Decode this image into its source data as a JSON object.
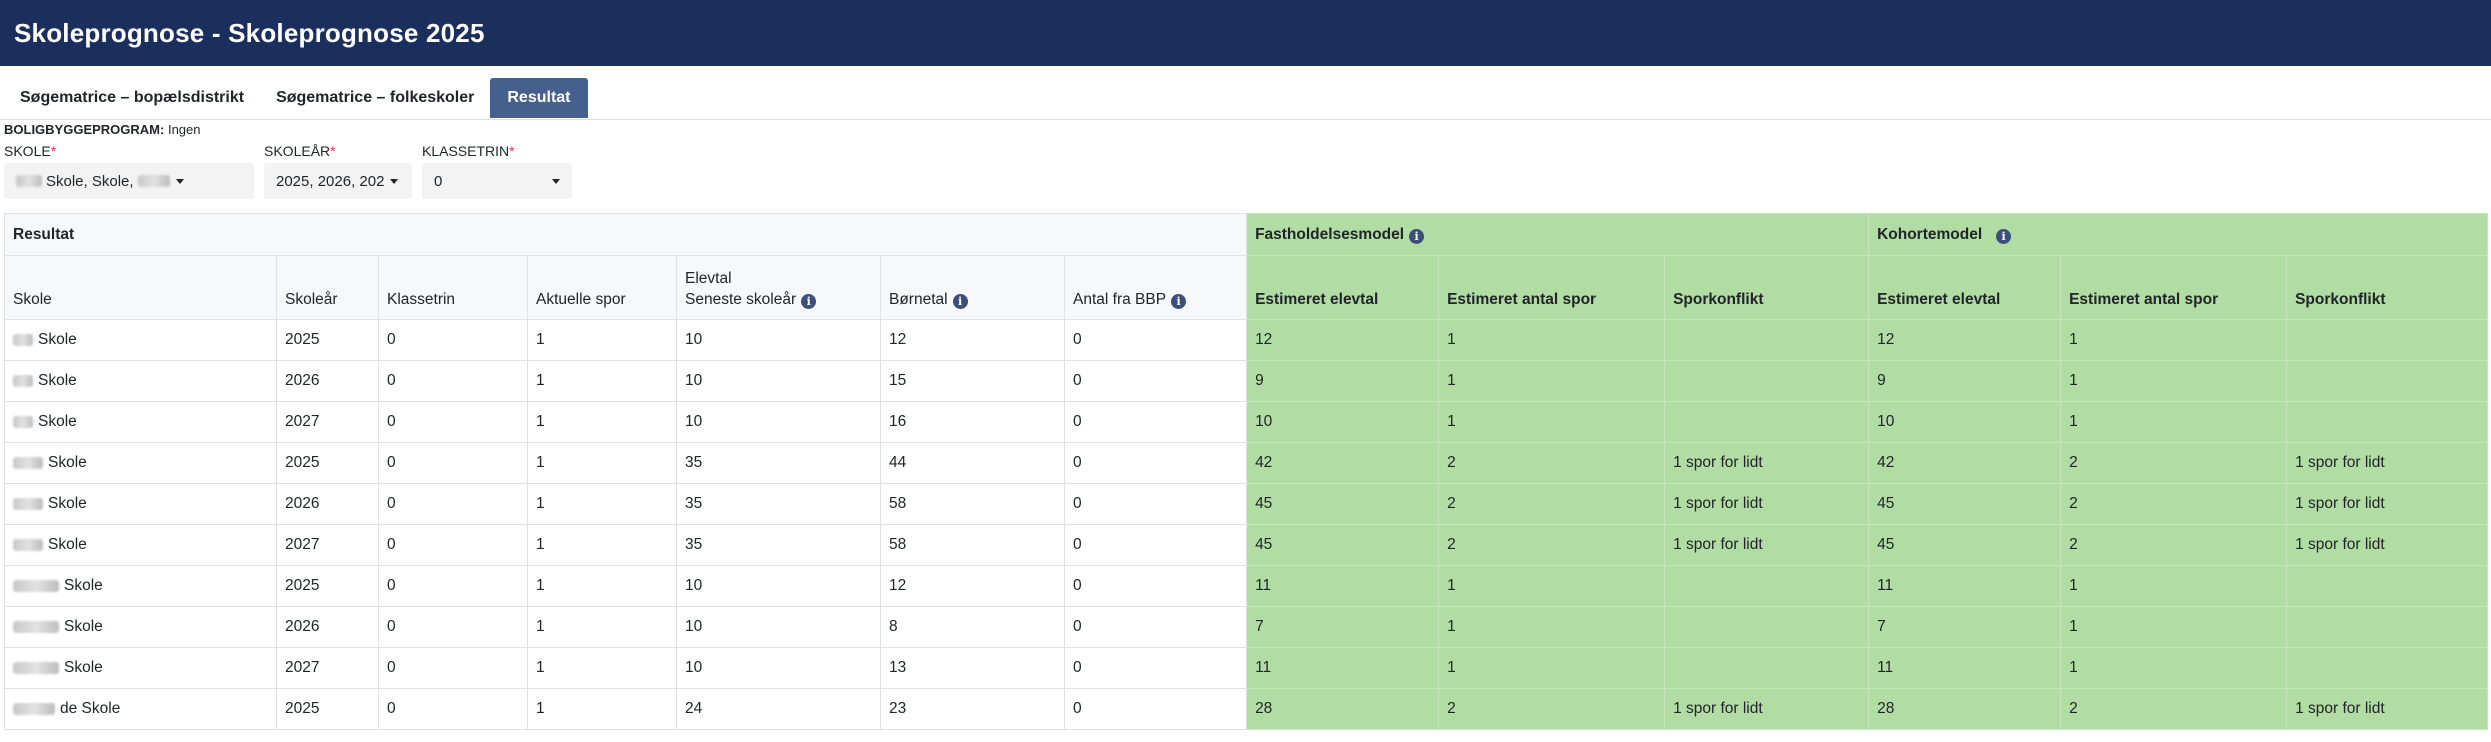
{
  "app": {
    "title": "Skoleprognose - Skoleprognose 2025"
  },
  "tabs": [
    {
      "label": "Søgematrice – bopælsdistrikt",
      "active": false
    },
    {
      "label": "Søgematrice – folkeskoler",
      "active": false
    },
    {
      "label": "Resultat",
      "active": true
    }
  ],
  "program": {
    "label": "BOLIGBYGGEPROGRAM:",
    "value": "Ingen"
  },
  "filters": {
    "school": {
      "label": "SKOLE",
      "required": "*",
      "value": "Skole, Skole,"
    },
    "year": {
      "label": "SKOLEÅR",
      "required": "*",
      "value": "2025, 2026, 202"
    },
    "class": {
      "label": "KLASSETRIN",
      "required": "*",
      "value": "0"
    }
  },
  "table": {
    "group_headers": {
      "result": "Resultat",
      "retention": "Fastholdelsesmodel",
      "cohort": "Kohortemodel"
    },
    "columns": {
      "school": "Skole",
      "year": "Skoleår",
      "grade": "Klassetrin",
      "tracks": "Aktuelle spor",
      "pupils_line1": "Elevtal",
      "pupils_line2": "Seneste skoleår",
      "children": "Børnetal",
      "bbp": "Antal fra BBP",
      "ret_est_pupils": "Estimeret elevtal",
      "ret_est_tracks": "Estimeret antal spor",
      "ret_conflict": "Sporkonflikt",
      "coh_est_pupils": "Estimeret elevtal",
      "coh_est_tracks": "Estimeret antal spor",
      "coh_conflict": "Sporkonflikt"
    },
    "rows": [
      {
        "school": "Skole",
        "year": "2025",
        "grade": "0",
        "tracks": "1",
        "pupils": "10",
        "children": "12",
        "bbp": "0",
        "r_pupils": "12",
        "r_tracks": "1",
        "r_conflict": "",
        "c_pupils": "12",
        "c_tracks": "1",
        "c_conflict": ""
      },
      {
        "school": "Skole",
        "year": "2026",
        "grade": "0",
        "tracks": "1",
        "pupils": "10",
        "children": "15",
        "bbp": "0",
        "r_pupils": "9",
        "r_tracks": "1",
        "r_conflict": "",
        "c_pupils": "9",
        "c_tracks": "1",
        "c_conflict": ""
      },
      {
        "school": "Skole",
        "year": "2027",
        "grade": "0",
        "tracks": "1",
        "pupils": "10",
        "children": "16",
        "bbp": "0",
        "r_pupils": "10",
        "r_tracks": "1",
        "r_conflict": "",
        "c_pupils": "10",
        "c_tracks": "1",
        "c_conflict": ""
      },
      {
        "school": "Skole",
        "year": "2025",
        "grade": "0",
        "tracks": "1",
        "pupils": "35",
        "children": "44",
        "bbp": "0",
        "r_pupils": "42",
        "r_tracks": "2",
        "r_conflict": "1 spor for lidt",
        "c_pupils": "42",
        "c_tracks": "2",
        "c_conflict": "1 spor for lidt"
      },
      {
        "school": "Skole",
        "year": "2026",
        "grade": "0",
        "tracks": "1",
        "pupils": "35",
        "children": "58",
        "bbp": "0",
        "r_pupils": "45",
        "r_tracks": "2",
        "r_conflict": "1 spor for lidt",
        "c_pupils": "45",
        "c_tracks": "2",
        "c_conflict": "1 spor for lidt"
      },
      {
        "school": "Skole",
        "year": "2027",
        "grade": "0",
        "tracks": "1",
        "pupils": "35",
        "children": "58",
        "bbp": "0",
        "r_pupils": "45",
        "r_tracks": "2",
        "r_conflict": "1 spor for lidt",
        "c_pupils": "45",
        "c_tracks": "2",
        "c_conflict": "1 spor for lidt"
      },
      {
        "school": "Skole",
        "year": "2025",
        "grade": "0",
        "tracks": "1",
        "pupils": "10",
        "children": "12",
        "bbp": "0",
        "r_pupils": "11",
        "r_tracks": "1",
        "r_conflict": "",
        "c_pupils": "11",
        "c_tracks": "1",
        "c_conflict": ""
      },
      {
        "school": "Skole",
        "year": "2026",
        "grade": "0",
        "tracks": "1",
        "pupils": "10",
        "children": "8",
        "bbp": "0",
        "r_pupils": "7",
        "r_tracks": "1",
        "r_conflict": "",
        "c_pupils": "7",
        "c_tracks": "1",
        "c_conflict": ""
      },
      {
        "school": "Skole",
        "year": "2027",
        "grade": "0",
        "tracks": "1",
        "pupils": "10",
        "children": "13",
        "bbp": "0",
        "r_pupils": "11",
        "r_tracks": "1",
        "r_conflict": "",
        "c_pupils": "11",
        "c_tracks": "1",
        "c_conflict": ""
      },
      {
        "school": "de Skole",
        "year": "2025",
        "grade": "0",
        "tracks": "1",
        "pupils": "24",
        "children": "23",
        "bbp": "0",
        "r_pupils": "28",
        "r_tracks": "2",
        "r_conflict": "1 spor for lidt",
        "c_pupils": "28",
        "c_tracks": "2",
        "c_conflict": "1 spor for lidt"
      }
    ]
  },
  "colors": {
    "header": "#1b2f5e",
    "active_tab": "#46608e",
    "model_green": "#b1dca3",
    "required": "#dc3545"
  }
}
